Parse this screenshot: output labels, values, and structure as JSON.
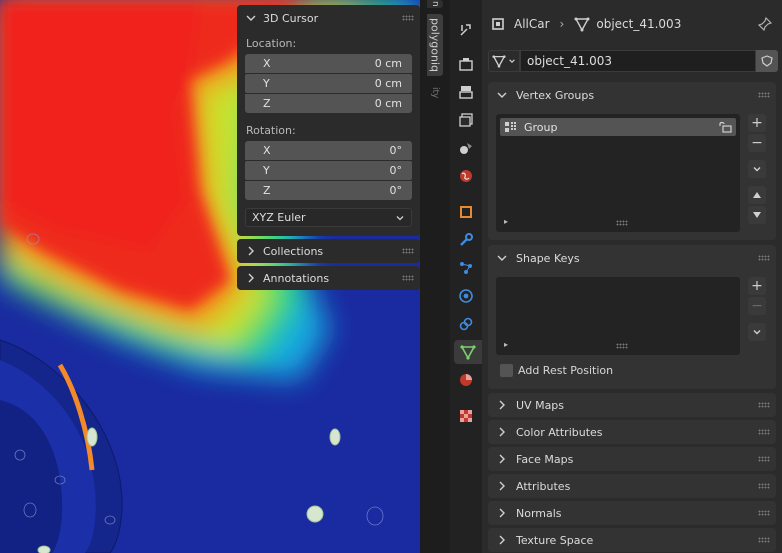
{
  "viewport": {
    "npanel": {
      "cursor_title": "3D Cursor",
      "location_label": "Location:",
      "location": [
        {
          "axis": "X",
          "value": "0 cm"
        },
        {
          "axis": "Y",
          "value": "0 cm"
        },
        {
          "axis": "Z",
          "value": "0 cm"
        }
      ],
      "rotation_label": "Rotation:",
      "rotation": [
        {
          "axis": "X",
          "value": "0°"
        },
        {
          "axis": "Y",
          "value": "0°"
        },
        {
          "axis": "Z",
          "value": "0°"
        }
      ],
      "rotation_mode": "XYZ Euler",
      "collections_title": "Collections",
      "annotations_title": "Annotations"
    },
    "side_tabs": [
      "n",
      "polygoniq",
      "ity"
    ]
  },
  "properties": {
    "breadcrumb": {
      "object": "AllCar",
      "data": "object_41.003"
    },
    "datablock_name": "object_41.003",
    "vertex_groups": {
      "title": "Vertex Groups",
      "items": [
        "Group"
      ]
    },
    "shape_keys": {
      "title": "Shape Keys",
      "add_rest_position": "Add Rest Position"
    },
    "collapsed_panels": [
      "UV Maps",
      "Color Attributes",
      "Face Maps",
      "Attributes",
      "Normals",
      "Texture Space"
    ]
  },
  "colors": {
    "accent": "#4772b3",
    "active_tab_icon": "#7bd16c"
  }
}
